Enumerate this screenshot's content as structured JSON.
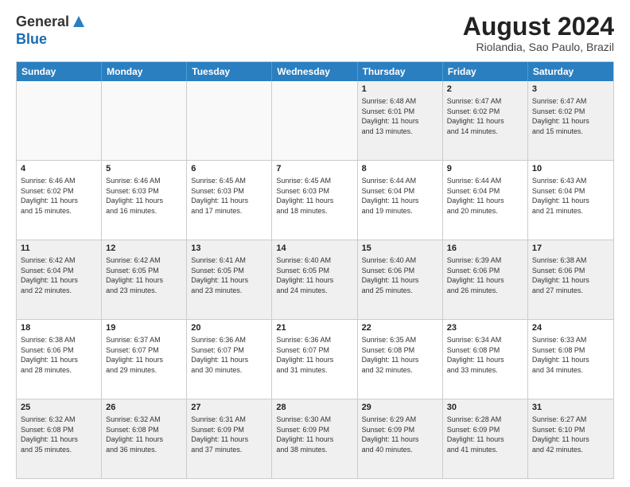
{
  "logo": {
    "general": "General",
    "blue": "Blue"
  },
  "title": {
    "month_year": "August 2024",
    "location": "Riolandia, Sao Paulo, Brazil"
  },
  "days_header": [
    "Sunday",
    "Monday",
    "Tuesday",
    "Wednesday",
    "Thursday",
    "Friday",
    "Saturday"
  ],
  "weeks": [
    [
      {
        "day": "",
        "info": "",
        "empty": true
      },
      {
        "day": "",
        "info": "",
        "empty": true
      },
      {
        "day": "",
        "info": "",
        "empty": true
      },
      {
        "day": "",
        "info": "",
        "empty": true
      },
      {
        "day": "1",
        "info": "Sunrise: 6:48 AM\nSunset: 6:01 PM\nDaylight: 11 hours\nand 13 minutes.",
        "empty": false
      },
      {
        "day": "2",
        "info": "Sunrise: 6:47 AM\nSunset: 6:02 PM\nDaylight: 11 hours\nand 14 minutes.",
        "empty": false
      },
      {
        "day": "3",
        "info": "Sunrise: 6:47 AM\nSunset: 6:02 PM\nDaylight: 11 hours\nand 15 minutes.",
        "empty": false
      }
    ],
    [
      {
        "day": "4",
        "info": "Sunrise: 6:46 AM\nSunset: 6:02 PM\nDaylight: 11 hours\nand 15 minutes.",
        "empty": false
      },
      {
        "day": "5",
        "info": "Sunrise: 6:46 AM\nSunset: 6:03 PM\nDaylight: 11 hours\nand 16 minutes.",
        "empty": false
      },
      {
        "day": "6",
        "info": "Sunrise: 6:45 AM\nSunset: 6:03 PM\nDaylight: 11 hours\nand 17 minutes.",
        "empty": false
      },
      {
        "day": "7",
        "info": "Sunrise: 6:45 AM\nSunset: 6:03 PM\nDaylight: 11 hours\nand 18 minutes.",
        "empty": false
      },
      {
        "day": "8",
        "info": "Sunrise: 6:44 AM\nSunset: 6:04 PM\nDaylight: 11 hours\nand 19 minutes.",
        "empty": false
      },
      {
        "day": "9",
        "info": "Sunrise: 6:44 AM\nSunset: 6:04 PM\nDaylight: 11 hours\nand 20 minutes.",
        "empty": false
      },
      {
        "day": "10",
        "info": "Sunrise: 6:43 AM\nSunset: 6:04 PM\nDaylight: 11 hours\nand 21 minutes.",
        "empty": false
      }
    ],
    [
      {
        "day": "11",
        "info": "Sunrise: 6:42 AM\nSunset: 6:04 PM\nDaylight: 11 hours\nand 22 minutes.",
        "empty": false
      },
      {
        "day": "12",
        "info": "Sunrise: 6:42 AM\nSunset: 6:05 PM\nDaylight: 11 hours\nand 23 minutes.",
        "empty": false
      },
      {
        "day": "13",
        "info": "Sunrise: 6:41 AM\nSunset: 6:05 PM\nDaylight: 11 hours\nand 23 minutes.",
        "empty": false
      },
      {
        "day": "14",
        "info": "Sunrise: 6:40 AM\nSunset: 6:05 PM\nDaylight: 11 hours\nand 24 minutes.",
        "empty": false
      },
      {
        "day": "15",
        "info": "Sunrise: 6:40 AM\nSunset: 6:06 PM\nDaylight: 11 hours\nand 25 minutes.",
        "empty": false
      },
      {
        "day": "16",
        "info": "Sunrise: 6:39 AM\nSunset: 6:06 PM\nDaylight: 11 hours\nand 26 minutes.",
        "empty": false
      },
      {
        "day": "17",
        "info": "Sunrise: 6:38 AM\nSunset: 6:06 PM\nDaylight: 11 hours\nand 27 minutes.",
        "empty": false
      }
    ],
    [
      {
        "day": "18",
        "info": "Sunrise: 6:38 AM\nSunset: 6:06 PM\nDaylight: 11 hours\nand 28 minutes.",
        "empty": false
      },
      {
        "day": "19",
        "info": "Sunrise: 6:37 AM\nSunset: 6:07 PM\nDaylight: 11 hours\nand 29 minutes.",
        "empty": false
      },
      {
        "day": "20",
        "info": "Sunrise: 6:36 AM\nSunset: 6:07 PM\nDaylight: 11 hours\nand 30 minutes.",
        "empty": false
      },
      {
        "day": "21",
        "info": "Sunrise: 6:36 AM\nSunset: 6:07 PM\nDaylight: 11 hours\nand 31 minutes.",
        "empty": false
      },
      {
        "day": "22",
        "info": "Sunrise: 6:35 AM\nSunset: 6:08 PM\nDaylight: 11 hours\nand 32 minutes.",
        "empty": false
      },
      {
        "day": "23",
        "info": "Sunrise: 6:34 AM\nSunset: 6:08 PM\nDaylight: 11 hours\nand 33 minutes.",
        "empty": false
      },
      {
        "day": "24",
        "info": "Sunrise: 6:33 AM\nSunset: 6:08 PM\nDaylight: 11 hours\nand 34 minutes.",
        "empty": false
      }
    ],
    [
      {
        "day": "25",
        "info": "Sunrise: 6:32 AM\nSunset: 6:08 PM\nDaylight: 11 hours\nand 35 minutes.",
        "empty": false
      },
      {
        "day": "26",
        "info": "Sunrise: 6:32 AM\nSunset: 6:08 PM\nDaylight: 11 hours\nand 36 minutes.",
        "empty": false
      },
      {
        "day": "27",
        "info": "Sunrise: 6:31 AM\nSunset: 6:09 PM\nDaylight: 11 hours\nand 37 minutes.",
        "empty": false
      },
      {
        "day": "28",
        "info": "Sunrise: 6:30 AM\nSunset: 6:09 PM\nDaylight: 11 hours\nand 38 minutes.",
        "empty": false
      },
      {
        "day": "29",
        "info": "Sunrise: 6:29 AM\nSunset: 6:09 PM\nDaylight: 11 hours\nand 40 minutes.",
        "empty": false
      },
      {
        "day": "30",
        "info": "Sunrise: 6:28 AM\nSunset: 6:09 PM\nDaylight: 11 hours\nand 41 minutes.",
        "empty": false
      },
      {
        "day": "31",
        "info": "Sunrise: 6:27 AM\nSunset: 6:10 PM\nDaylight: 11 hours\nand 42 minutes.",
        "empty": false
      }
    ]
  ]
}
